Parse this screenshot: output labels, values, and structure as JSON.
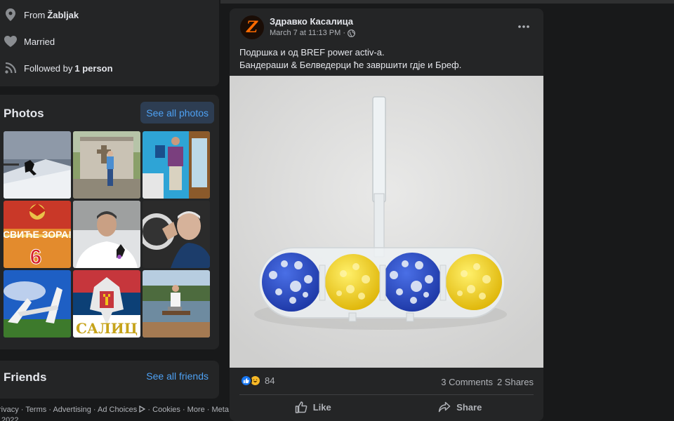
{
  "intro": {
    "from_prefix": "From",
    "from_place": "Žabljak",
    "relationship": "Married",
    "followed_prefix": "Followed by",
    "followed_count": "1 person"
  },
  "photos": {
    "title": "Photos",
    "see_all": "See all photos",
    "items": [
      {
        "subject": "snowboarder on snowy slope"
      },
      {
        "subject": "man at monument with cross"
      },
      {
        "subject": "man in suit by window"
      },
      {
        "subject": "poster with text",
        "text_line1": "СВИЋЕ ЗОРА!",
        "text_line2": "6"
      },
      {
        "subject": "man with ribbon portrait"
      },
      {
        "subject": "man clapping before crowd"
      },
      {
        "subject": "white monument under blue sky"
      },
      {
        "subject": "flag with eagle",
        "text": "САЛИЦ"
      },
      {
        "subject": "man sitting by lake"
      }
    ]
  },
  "friends": {
    "title": "Friends",
    "see_all": "See all friends"
  },
  "footer": {
    "links": [
      "rivacy",
      "Terms",
      "Advertising",
      "Ad Choices",
      "Cookies",
      "More",
      "Meta"
    ],
    "separator": " · ",
    "year_line": "2022"
  },
  "post": {
    "author": "Здравко Касалица",
    "avatar_letter": "Z",
    "timestamp": "March 7 at 11:13 PM",
    "audience_icon": "globe-icon",
    "text_line1": "Подршка и од BREF power activ-a.",
    "text_line2": "Бандераши & Белведерци ће завршити гдје и Бреф.",
    "image_subject": "toilet freshener with blue and yellow balls",
    "reaction_count": "84",
    "comments": "3 Comments",
    "shares": "2 Shares",
    "like_label": "Like",
    "share_label": "Share"
  },
  "colors": {
    "background": "#18191a",
    "card": "#242526",
    "link": "#4ea1f3",
    "like_blue": "#1877f2",
    "haha_yellow": "#f7b928",
    "ukraine_blue": "#2547c8",
    "ukraine_yellow": "#f5d21a"
  }
}
